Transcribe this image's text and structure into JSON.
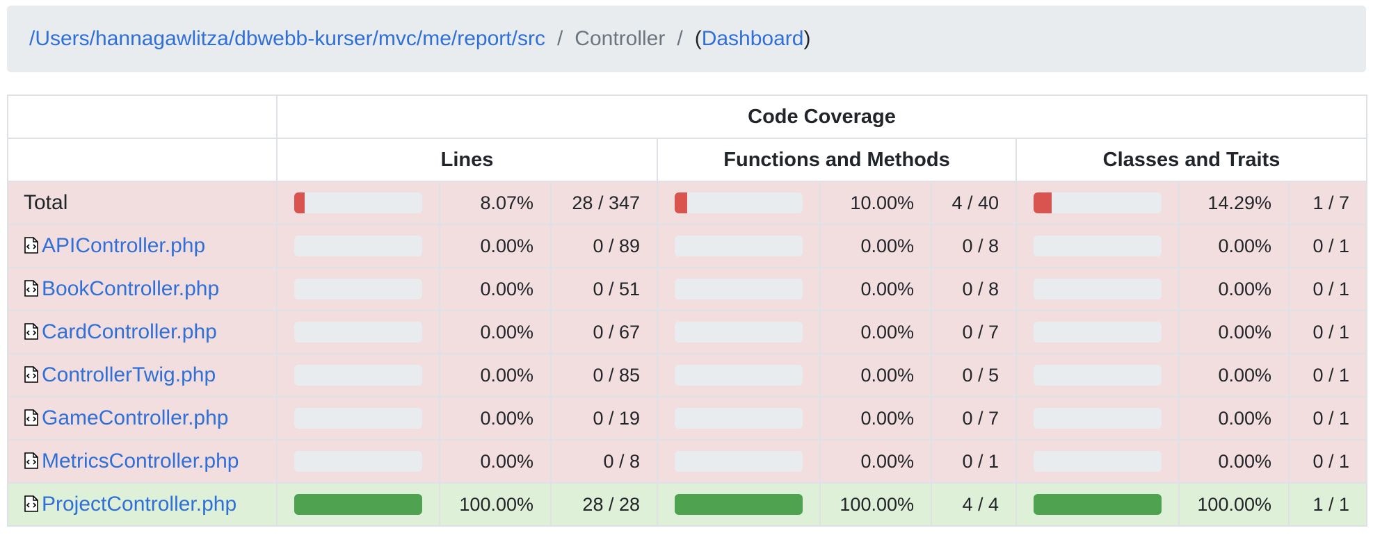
{
  "breadcrumb": {
    "path": "/Users/hannagawlitza/dbwebb-kurser/mvc/me/report/src",
    "current": "Controller",
    "dashboard_prefix": "(",
    "dashboard": "Dashboard",
    "dashboard_suffix": ")",
    "separator": "/"
  },
  "table": {
    "header": "Code Coverage",
    "groups": [
      "Lines",
      "Functions and Methods",
      "Classes and Traits"
    ],
    "rows": [
      {
        "name": "Total",
        "is_file": false,
        "status": "danger",
        "lines": {
          "progress": 8.07,
          "pct": "8.07%",
          "ratio": "28 / 347"
        },
        "methods": {
          "progress": 10.0,
          "pct": "10.00%",
          "ratio": "4 / 40"
        },
        "classes": {
          "progress": 14.29,
          "pct": "14.29%",
          "ratio": "1 / 7"
        }
      },
      {
        "name": "APIController.php",
        "is_file": true,
        "status": "danger",
        "lines": {
          "progress": 0,
          "pct": "0.00%",
          "ratio": "0 / 89"
        },
        "methods": {
          "progress": 0,
          "pct": "0.00%",
          "ratio": "0 / 8"
        },
        "classes": {
          "progress": 0,
          "pct": "0.00%",
          "ratio": "0 / 1"
        }
      },
      {
        "name": "BookController.php",
        "is_file": true,
        "status": "danger",
        "lines": {
          "progress": 0,
          "pct": "0.00%",
          "ratio": "0 / 51"
        },
        "methods": {
          "progress": 0,
          "pct": "0.00%",
          "ratio": "0 / 8"
        },
        "classes": {
          "progress": 0,
          "pct": "0.00%",
          "ratio": "0 / 1"
        }
      },
      {
        "name": "CardController.php",
        "is_file": true,
        "status": "danger",
        "lines": {
          "progress": 0,
          "pct": "0.00%",
          "ratio": "0 / 67"
        },
        "methods": {
          "progress": 0,
          "pct": "0.00%",
          "ratio": "0 / 7"
        },
        "classes": {
          "progress": 0,
          "pct": "0.00%",
          "ratio": "0 / 1"
        }
      },
      {
        "name": "ControllerTwig.php",
        "is_file": true,
        "status": "danger",
        "lines": {
          "progress": 0,
          "pct": "0.00%",
          "ratio": "0 / 85"
        },
        "methods": {
          "progress": 0,
          "pct": "0.00%",
          "ratio": "0 / 5"
        },
        "classes": {
          "progress": 0,
          "pct": "0.00%",
          "ratio": "0 / 1"
        }
      },
      {
        "name": "GameController.php",
        "is_file": true,
        "status": "danger",
        "lines": {
          "progress": 0,
          "pct": "0.00%",
          "ratio": "0 / 19"
        },
        "methods": {
          "progress": 0,
          "pct": "0.00%",
          "ratio": "0 / 7"
        },
        "classes": {
          "progress": 0,
          "pct": "0.00%",
          "ratio": "0 / 1"
        }
      },
      {
        "name": "MetricsController.php",
        "is_file": true,
        "status": "danger",
        "lines": {
          "progress": 0,
          "pct": "0.00%",
          "ratio": "0 / 8"
        },
        "methods": {
          "progress": 0,
          "pct": "0.00%",
          "ratio": "0 / 1"
        },
        "classes": {
          "progress": 0,
          "pct": "0.00%",
          "ratio": "0 / 1"
        }
      },
      {
        "name": "ProjectController.php",
        "is_file": true,
        "status": "success",
        "lines": {
          "progress": 100,
          "pct": "100.00%",
          "ratio": "28 / 28"
        },
        "methods": {
          "progress": 100,
          "pct": "100.00%",
          "ratio": "4 / 4"
        },
        "classes": {
          "progress": 100,
          "pct": "100.00%",
          "ratio": "1 / 1"
        }
      }
    ]
  },
  "colors": {
    "link": "#2f6fd8",
    "danger_row": "#f2dede",
    "success_row": "#dff0d8",
    "bar_low": "#d9534f",
    "bar_high": "#4fa350",
    "bar_track": "#e9ecef"
  },
  "icons": {
    "file": "php-file-icon"
  }
}
